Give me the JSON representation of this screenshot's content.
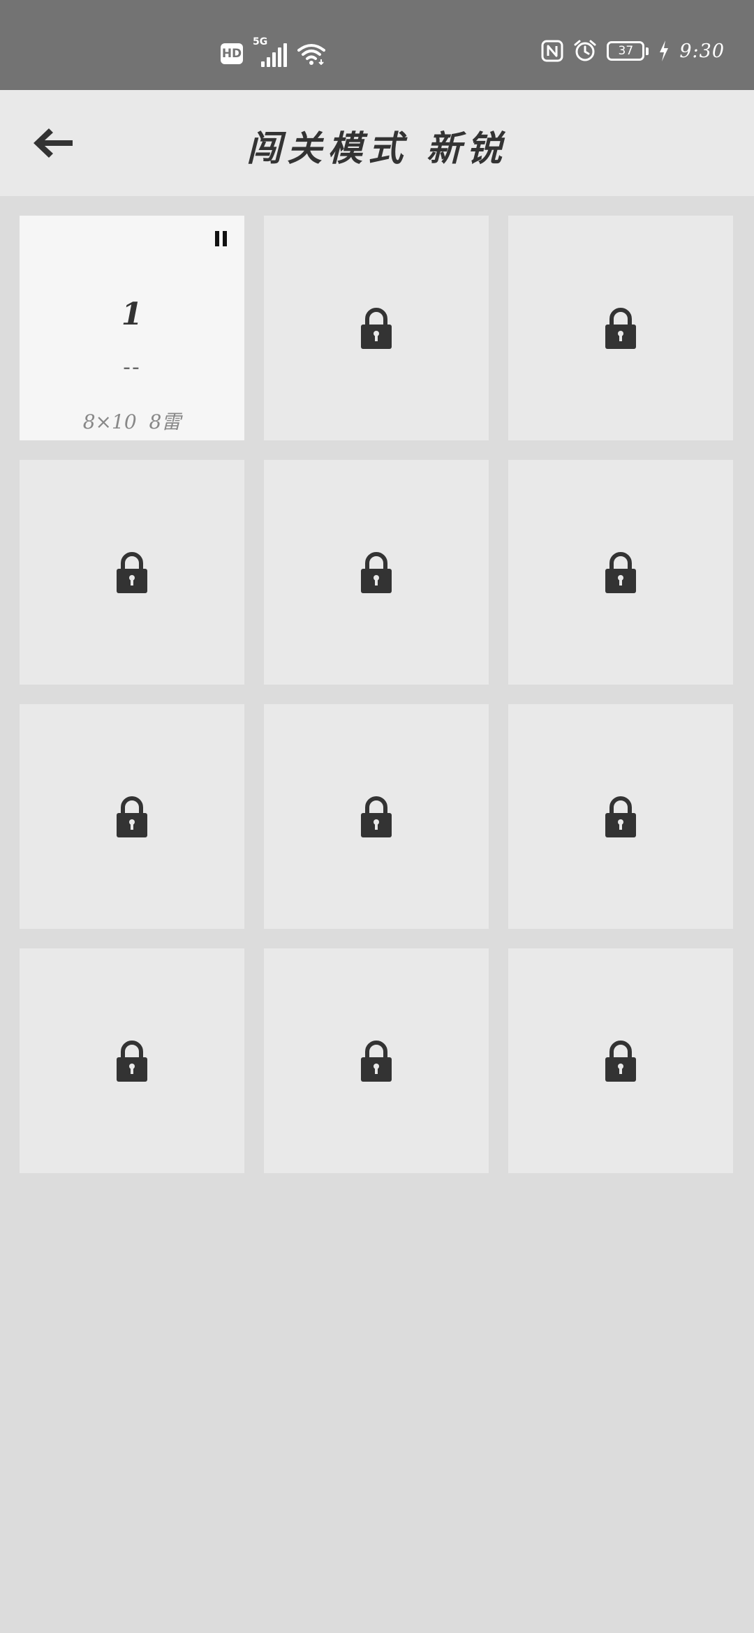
{
  "status_bar": {
    "hd_label": "HD",
    "network_label": "5G",
    "battery_level": "37",
    "time": "9:30",
    "icons": [
      "hd-icon",
      "cellular-signal-icon",
      "wifi-icon",
      "nfc-icon",
      "alarm-icon",
      "battery-icon",
      "charging-icon"
    ]
  },
  "header": {
    "back_icon": "arrow-left-icon",
    "title": "闯关模式 新锐"
  },
  "levels": [
    {
      "state": "unlocked",
      "number": "1",
      "best": "--",
      "config": "8×10  8雷",
      "icon": "pause-icon"
    },
    {
      "state": "locked",
      "icon": "lock-icon"
    },
    {
      "state": "locked",
      "icon": "lock-icon"
    },
    {
      "state": "locked",
      "icon": "lock-icon"
    },
    {
      "state": "locked",
      "icon": "lock-icon"
    },
    {
      "state": "locked",
      "icon": "lock-icon"
    },
    {
      "state": "locked",
      "icon": "lock-icon"
    },
    {
      "state": "locked",
      "icon": "lock-icon"
    },
    {
      "state": "locked",
      "icon": "lock-icon"
    },
    {
      "state": "locked",
      "icon": "lock-icon"
    },
    {
      "state": "locked",
      "icon": "lock-icon"
    },
    {
      "state": "locked",
      "icon": "lock-icon"
    }
  ],
  "colors": {
    "status_bar_bg": "#737373",
    "header_bg": "#e9e9e9",
    "page_bg": "#dcdcdc",
    "tile_locked_bg": "#e9e9e9",
    "tile_unlocked_bg": "#f6f6f6",
    "icon_dark": "#333333"
  }
}
